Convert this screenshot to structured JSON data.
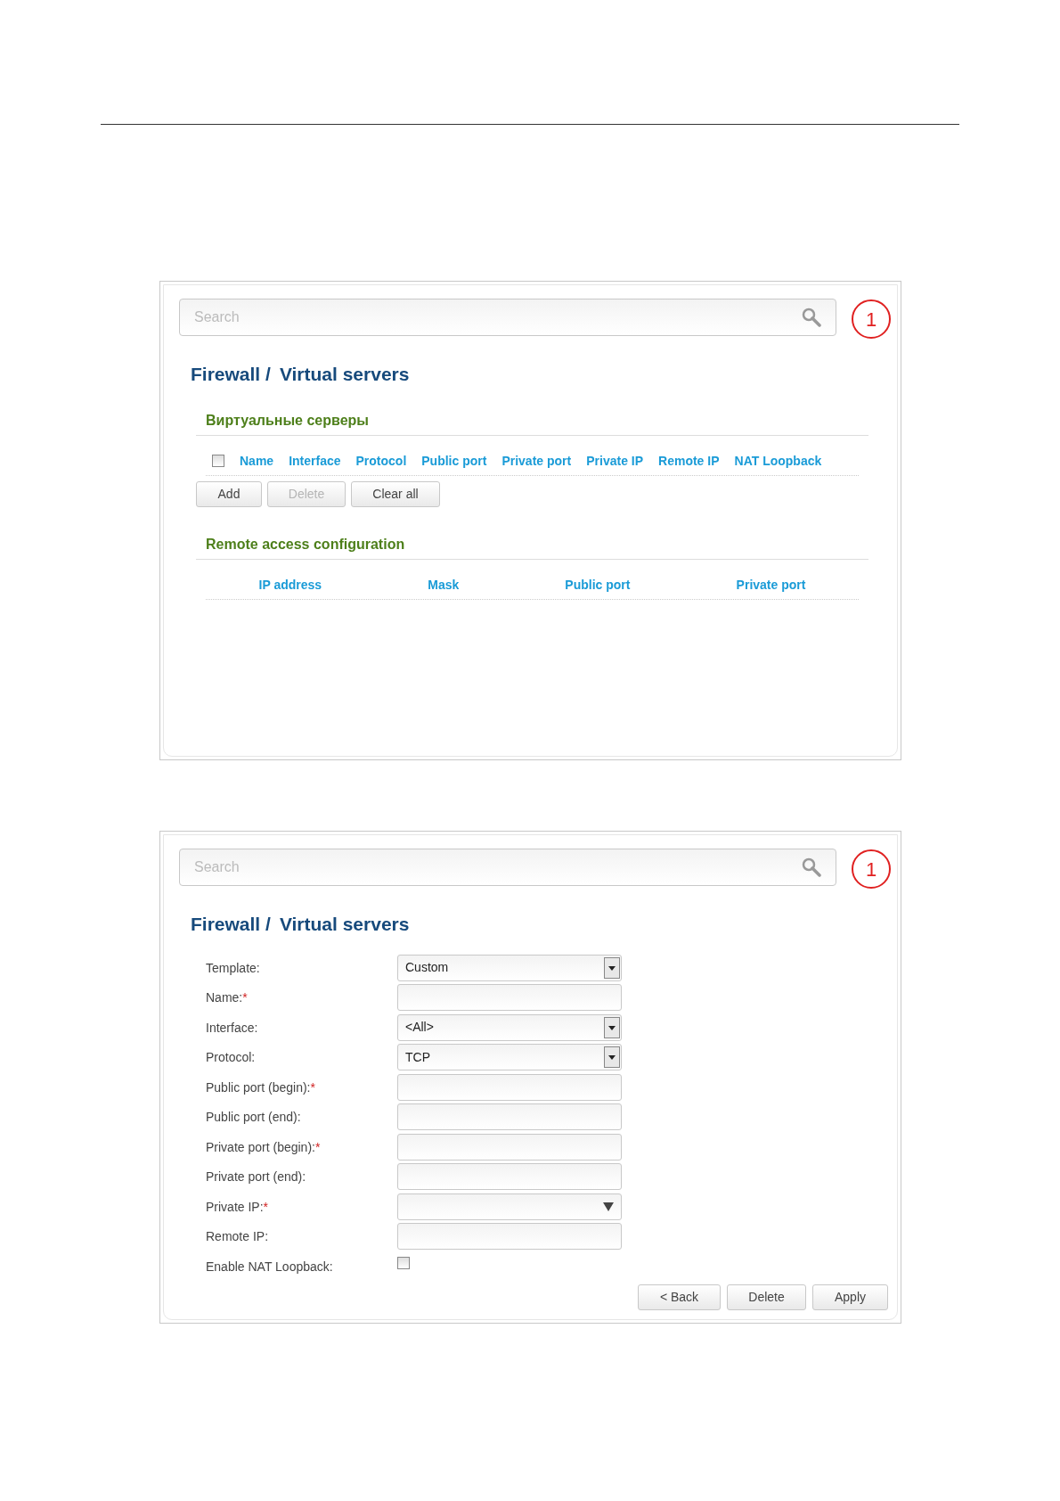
{
  "screens": [
    {
      "kind": "list",
      "search": {
        "placeholder": "Search"
      },
      "badge": "1",
      "breadcrumb": [
        "Firewall /",
        "Virtual servers"
      ],
      "sections": [
        {
          "title": "Виртуальные серверы",
          "select_all": {
            "checked": false
          },
          "columns": [
            "Name",
            "Interface",
            "Protocol",
            "Public port",
            "Private port",
            "Private IP",
            "Remote IP",
            "NAT Loopback"
          ],
          "buttons": [
            {
              "label": "Add",
              "disabled": false
            },
            {
              "label": "Delete",
              "disabled": true
            },
            {
              "label": "Clear all",
              "disabled": false
            }
          ]
        },
        {
          "title": "Remote access configuration",
          "columns": [
            "IP address",
            "Mask",
            "Public port",
            "Private port"
          ]
        }
      ]
    },
    {
      "kind": "form",
      "search": {
        "placeholder": "Search"
      },
      "badge": "1",
      "breadcrumb": [
        "Firewall /",
        "Virtual servers"
      ],
      "fields": [
        {
          "label": "Template:",
          "kind": "select",
          "value": "Custom"
        },
        {
          "label": "Name:",
          "mark": "*",
          "kind": "text"
        },
        {
          "label": "Interface:",
          "kind": "select",
          "value": "<All>"
        },
        {
          "label": "Protocol:",
          "kind": "select",
          "value": "TCP"
        },
        {
          "label": "Public port (begin):",
          "mark": "*",
          "kind": "text"
        },
        {
          "label": "Public port (end):",
          "kind": "text"
        },
        {
          "label": "Private port (begin):",
          "mark": "*",
          "kind": "text"
        },
        {
          "label": "Private port (end):",
          "kind": "text"
        },
        {
          "label": "Private IP:",
          "mark": "*",
          "kind": "combo"
        },
        {
          "label": "Remote IP:",
          "kind": "text"
        },
        {
          "label": "Enable NAT Loopback:",
          "kind": "checkbox",
          "checked": false
        }
      ],
      "buttons": [
        {
          "label": "< Back",
          "disabled": false
        },
        {
          "label": "Delete",
          "disabled": false
        },
        {
          "label": "Apply",
          "disabled": false
        }
      ]
    }
  ]
}
